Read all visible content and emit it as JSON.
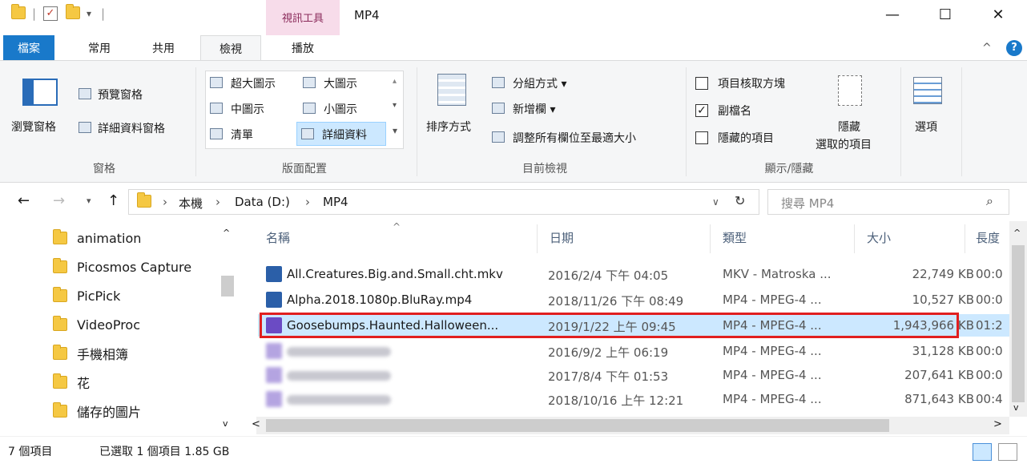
{
  "titlebar": {
    "context_group": "視訊工具",
    "title": "MP4",
    "minimize": "—",
    "maximize": "☐",
    "close": "✕"
  },
  "tabs": [
    {
      "label": "檔案"
    },
    {
      "label": "常用"
    },
    {
      "label": "共用"
    },
    {
      "label": "檢視"
    },
    {
      "label": "播放"
    }
  ],
  "ribbon": {
    "panes": {
      "nav_pane": "瀏覽窗格",
      "preview_pane": "預覽窗格",
      "details_pane": "詳細資料窗格",
      "group_label": "窗格"
    },
    "layout": {
      "items": [
        "超大圖示",
        "大圖示",
        "中圖示",
        "小圖示",
        "清單",
        "詳細資料"
      ],
      "group_label": "版面配置"
    },
    "current_view": {
      "sort": "排序方式",
      "group_by": "分組方式 ▾",
      "add_columns": "新增欄 ▾",
      "size_columns": "調整所有欄位至最適大小",
      "group_label": "目前檢視"
    },
    "show_hide": {
      "item_checkboxes": "項目核取方塊",
      "extensions": "副檔名",
      "hidden_items": "隱藏的項目",
      "hide_selected_line1": "隱藏",
      "hide_selected_line2": "選取的項目",
      "group_label": "顯示/隱藏"
    },
    "options": "選項"
  },
  "address": {
    "crumbs": [
      "本機",
      "Data (D:)",
      "MP4"
    ],
    "search_placeholder": "搜尋 MP4"
  },
  "nav": {
    "items": [
      "animation",
      "Picosmos Capture",
      "PicPick",
      "VideoProc",
      "手機相簿",
      "花",
      "儲存的圖片"
    ]
  },
  "list": {
    "headers": {
      "name": "名稱",
      "date": "日期",
      "type": "類型",
      "size": "大小",
      "length": "長度"
    },
    "rows": [
      {
        "name": "All.Creatures.Big.and.Small.cht.mkv",
        "date": "2016/2/4 下午 04:05",
        "type": "MKV - Matroska ...",
        "size": "22,749 KB",
        "length": "00:0"
      },
      {
        "name": "Alpha.2018.1080p.BluRay.mp4",
        "date": "2018/11/26 下午 08:49",
        "type": "MP4 - MPEG-4 ...",
        "size": "10,527 KB",
        "length": "00:0"
      },
      {
        "name": "Goosebumps.Haunted.Halloween...",
        "date": "2019/1/22 上午 09:45",
        "type": "MP4 - MPEG-4 ...",
        "size": "1,943,966 KB",
        "length": "01:2"
      },
      {
        "name": "",
        "date": "2016/9/2 上午 06:19",
        "type": "MP4 - MPEG-4 ...",
        "size": "31,128 KB",
        "length": "00:0"
      },
      {
        "name": "",
        "date": "2017/8/4 下午 01:53",
        "type": "MP4 - MPEG-4 ...",
        "size": "207,641 KB",
        "length": "00:0"
      },
      {
        "name": "",
        "date": "2018/10/16 上午 12:21",
        "type": "MP4 - MPEG-4 ...",
        "size": "871,643 KB",
        "length": "00:4"
      }
    ]
  },
  "status": {
    "count": "7 個項目",
    "selected": "已選取 1 個項目 1.85 GB"
  }
}
